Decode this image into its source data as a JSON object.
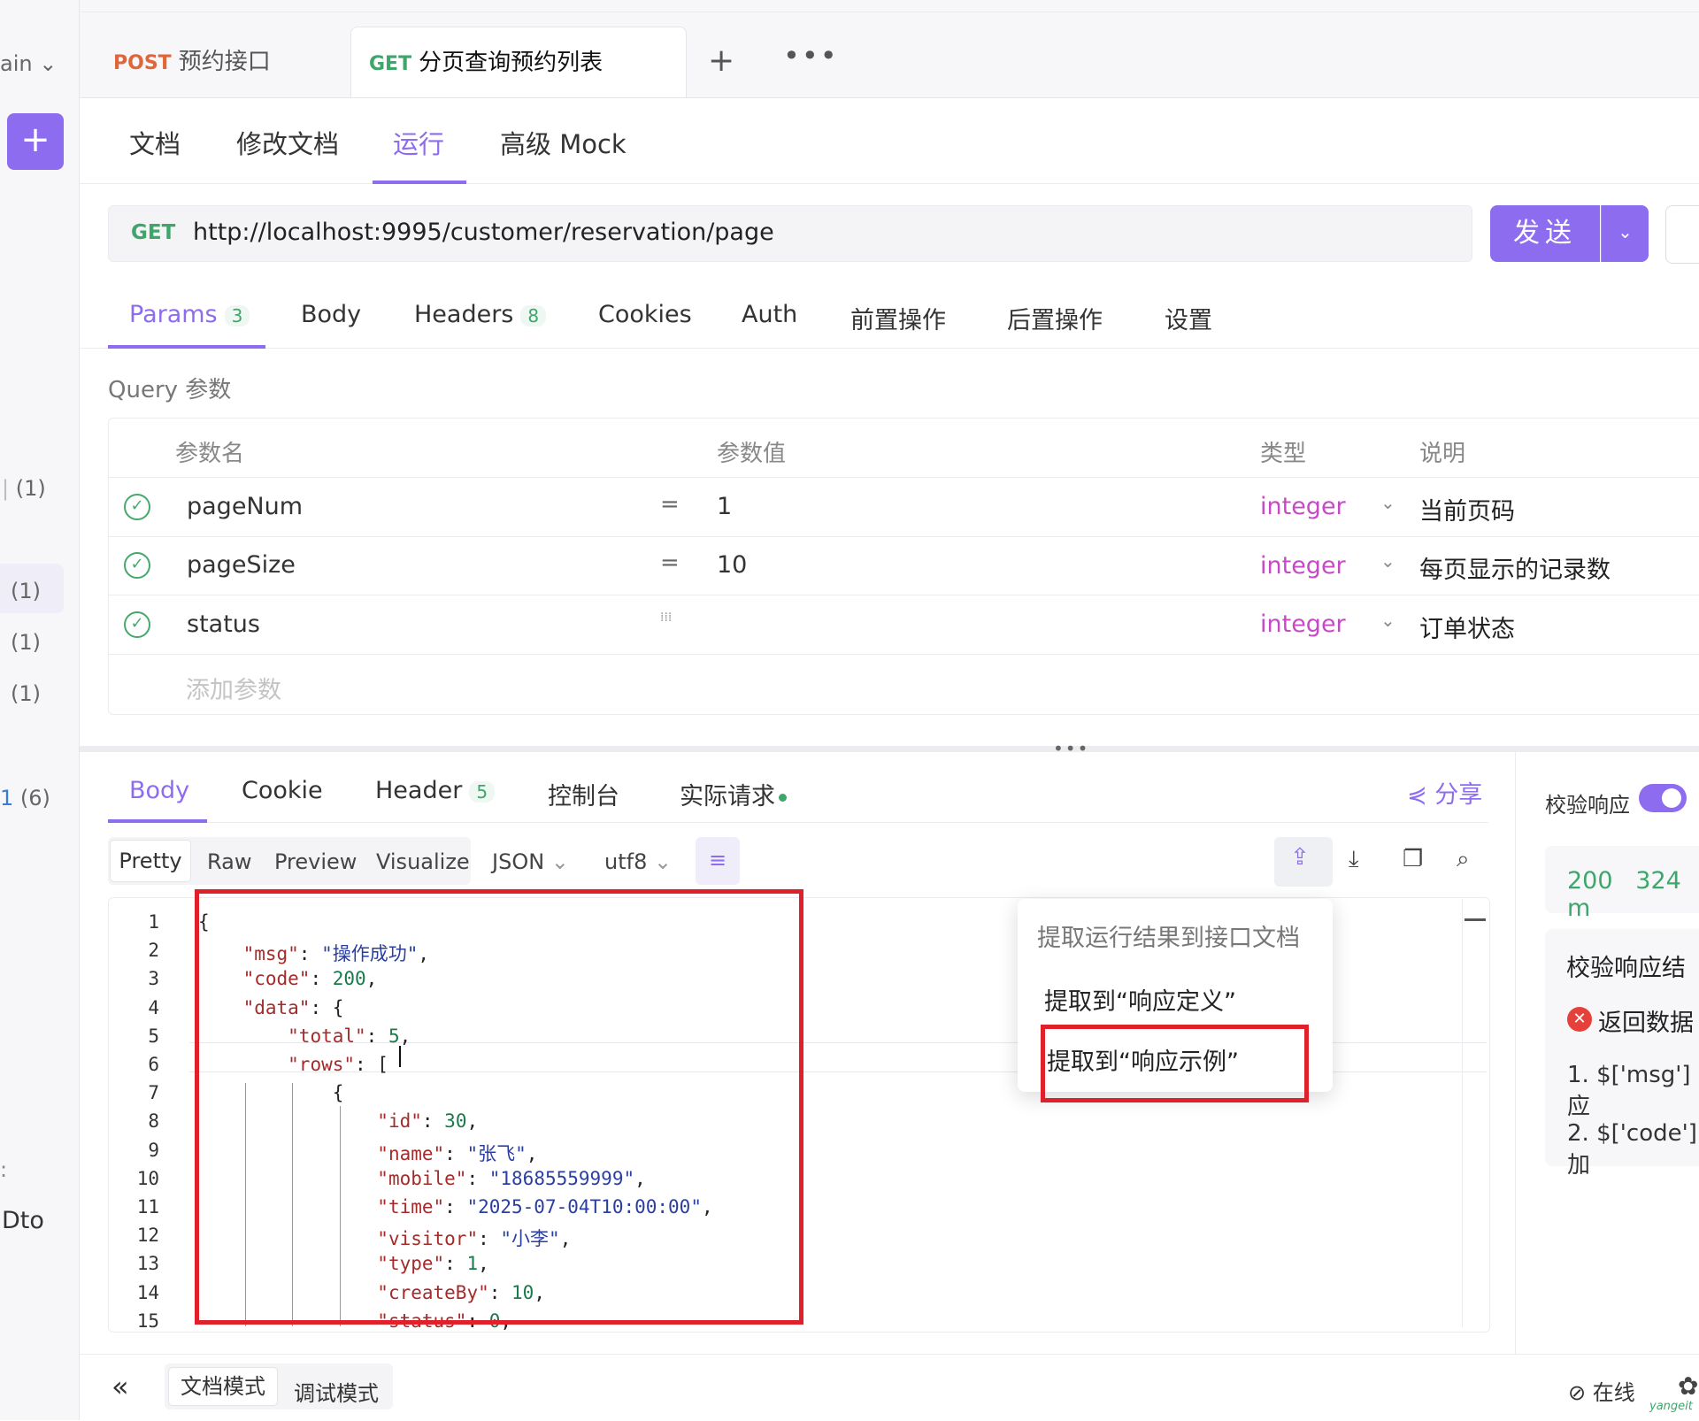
{
  "sidebar": {
    "branch_label": "ain",
    "items": [
      {
        "count": "(1)"
      },
      {
        "count": "(1)"
      },
      {
        "count": "(1)"
      },
      {
        "count": "(1)"
      },
      {
        "prefix": "1",
        "count": "(6)"
      }
    ],
    "bottom_fragment": "Dto"
  },
  "tabs": [
    {
      "method": "POST",
      "title": "预约接口"
    },
    {
      "method": "GET",
      "title": "分页查询预约列表",
      "active": true
    }
  ],
  "doc_tabs": [
    "文档",
    "修改文档",
    "运行",
    "高级 Mock"
  ],
  "doc_tabs_active": "运行",
  "request": {
    "method": "GET",
    "url": "http://localhost:9995/customer/reservation/page",
    "send_label": "发送"
  },
  "param_tabs": {
    "params": "Params",
    "params_count": "3",
    "body": "Body",
    "headers": "Headers",
    "headers_count": "8",
    "cookies": "Cookies",
    "auth": "Auth",
    "pre": "前置操作",
    "post": "后置操作",
    "settings": "设置"
  },
  "query": {
    "label": "Query 参数",
    "headers": {
      "name": "参数名",
      "value": "参数值",
      "type": "类型",
      "desc": "说明"
    },
    "rows": [
      {
        "name": "pageNum",
        "value": "1",
        "type": "integer",
        "desc": "当前页码"
      },
      {
        "name": "pageSize",
        "value": "10",
        "type": "integer",
        "desc": "每页显示的记录数"
      },
      {
        "name": "status",
        "value": "",
        "type": "integer",
        "desc": "订单状态"
      }
    ],
    "add_placeholder": "添加参数"
  },
  "response_tabs": {
    "body": "Body",
    "cookie": "Cookie",
    "header": "Header",
    "header_count": "5",
    "console": "控制台",
    "actual": "实际请求",
    "share": "分享"
  },
  "format": {
    "modes": [
      "Pretty",
      "Raw",
      "Preview",
      "Visualize"
    ],
    "lang": "JSON",
    "encoding": "utf8"
  },
  "code_lines": [
    "{",
    "    \"msg\": \"操作成功\",",
    "    \"code\": 200,",
    "    \"data\": {",
    "        \"total\": 5,",
    "        \"rows\": [",
    "            {",
    "                \"id\": 30,",
    "                \"name\": \"张飞\",",
    "                \"mobile\": \"18685559999\",",
    "                \"time\": \"2025-07-04T10:00:00\",",
    "                \"visitor\": \"小李\",",
    "                \"type\": 1,",
    "                \"createBy\": 10,",
    "                \"status\": 0,"
  ],
  "popup": {
    "title": "提取运行结果到接口文档",
    "to_definition": "提取到“响应定义”",
    "to_example": "提取到“响应示例”"
  },
  "verify_panel": {
    "label": "校验响应",
    "status_code": "200",
    "time_fragment": "324 m",
    "title": "校验响应结",
    "error": "返回数据",
    "item1": "1. $['msg'] 应",
    "item2": "2. $['code'] 加"
  },
  "bottom": {
    "doc_mode": "文档模式",
    "debug_mode": "调试模式",
    "online": "在线",
    "watermark": "yangeit"
  },
  "colors": {
    "accent": "#8e6cf0",
    "get": "#3fa66b",
    "post": "#e0663a",
    "highlight": "#e0202a",
    "type": "#c64ac6"
  }
}
